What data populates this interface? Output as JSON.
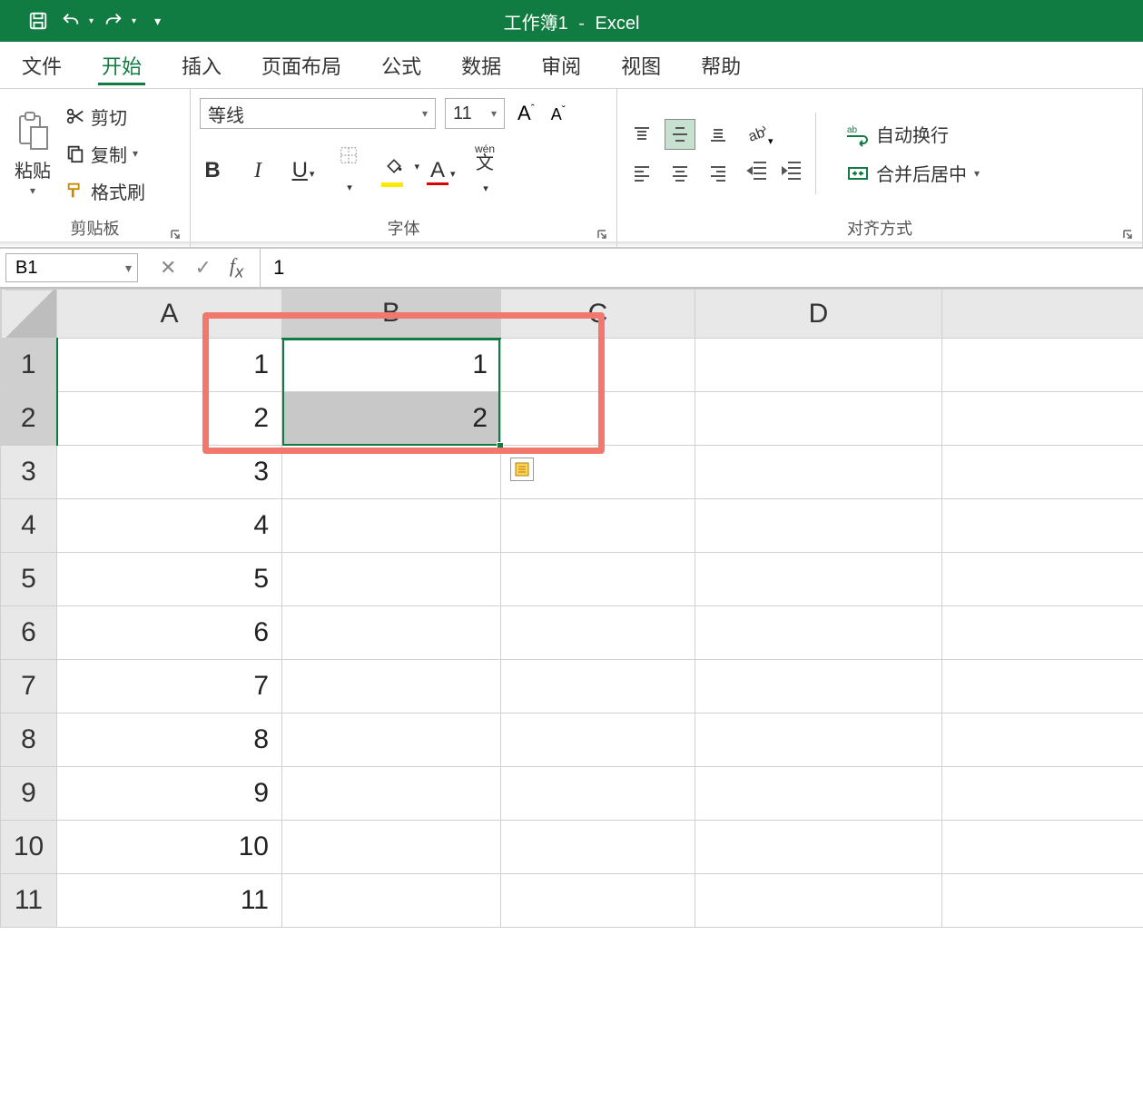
{
  "titlebar": {
    "workbook": "工作簿1",
    "dash": "-",
    "app": "Excel"
  },
  "tabs": {
    "file": "文件",
    "home": "开始",
    "insert": "插入",
    "layout": "页面布局",
    "formulas": "公式",
    "data": "数据",
    "review": "审阅",
    "view": "视图",
    "help": "帮助"
  },
  "ribbon": {
    "clipboard": {
      "paste": "粘贴",
      "cut": "剪切",
      "copy": "复制",
      "format_painter": "格式刷",
      "group": "剪贴板"
    },
    "font": {
      "name": "等线",
      "size": "11",
      "bold": "B",
      "italic": "I",
      "underline": "U",
      "increase": "A",
      "decrease": "A",
      "ruby_top": "wén",
      "ruby_bot": "文",
      "group": "字体"
    },
    "alignment": {
      "wrap": "自动换行",
      "merge": "合并后居中",
      "group": "对齐方式"
    }
  },
  "formula_bar": {
    "name_box": "B1",
    "value": "1"
  },
  "grid": {
    "columns": [
      "A",
      "B",
      "C",
      "D"
    ],
    "rows": [
      "1",
      "2",
      "3",
      "4",
      "5",
      "6",
      "7",
      "8",
      "9",
      "10",
      "11"
    ],
    "cells": {
      "A1": "1",
      "A2": "2",
      "A3": "3",
      "A4": "4",
      "A5": "5",
      "A6": "6",
      "A7": "7",
      "A8": "8",
      "A9": "9",
      "A10": "10",
      "A11": "11",
      "B1": "1",
      "B2": "2"
    },
    "selected_col": "B",
    "selected_rows": [
      "1",
      "2"
    ],
    "active_cell": "B1",
    "selection_range": "B1:B2"
  }
}
